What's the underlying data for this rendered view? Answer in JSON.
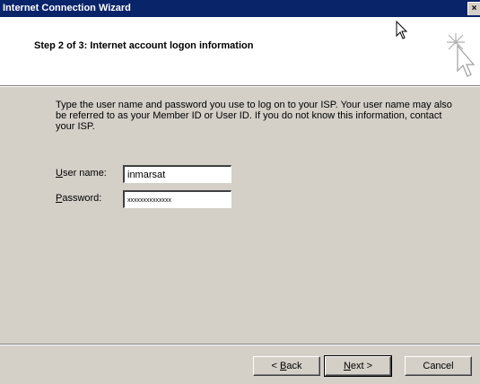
{
  "window": {
    "title": "Internet Connection Wizard",
    "close_glyph": "×"
  },
  "header": {
    "step_title": "Step 2 of 3: Internet account logon information",
    "wizard_icon": "wizard-sparkle-cursor-icon"
  },
  "body": {
    "instructions": "Type the user name and password you use to log on to your ISP. Your user name may also be referred to as your Member ID or User ID. If you do not know this information, contact your ISP."
  },
  "form": {
    "username_label_accel": "U",
    "username_label_rest": "ser name:",
    "username_value": "inmarsat",
    "password_label_accel": "P",
    "password_label_rest": "assword:",
    "password_mask": "xxxxxxxxxxxxxx"
  },
  "buttons": {
    "back_prefix": "< ",
    "back_accel": "B",
    "back_rest": "ack",
    "next_accel": "N",
    "next_rest": "ext >",
    "cancel": "Cancel"
  }
}
